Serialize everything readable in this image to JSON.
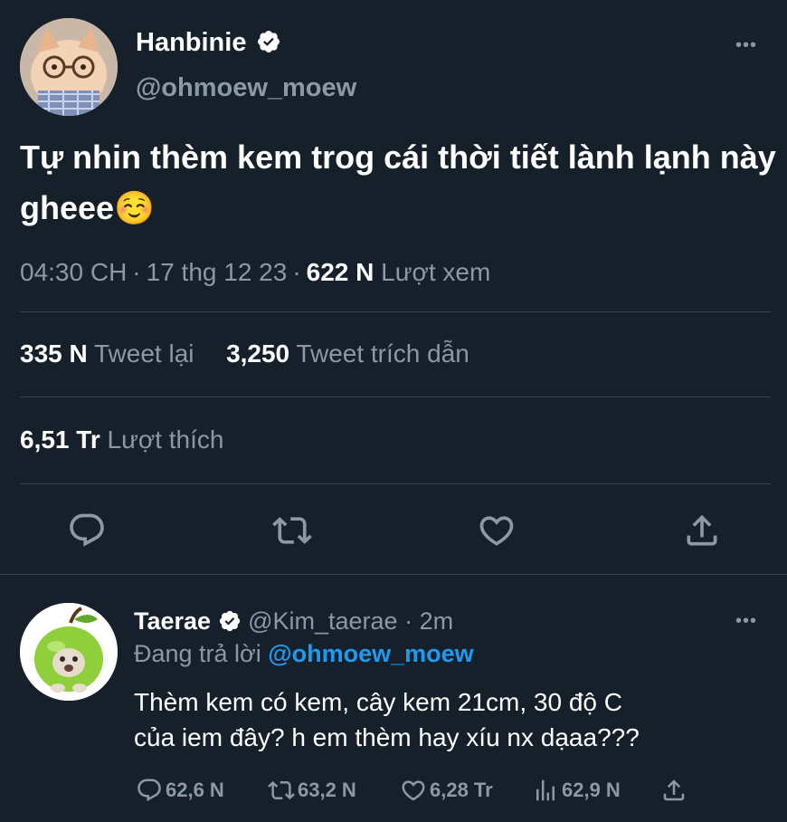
{
  "tweet": {
    "author_name": "Hanbinie",
    "author_handle": "@ohmoew_moew",
    "more_label": "•••",
    "text": "Tự nhin thèm kem trog cái thời tiết lành lạnh này gheee☺️",
    "time": "04:30 CH",
    "date": "17 thg 12 23",
    "views_count": "622 N",
    "views_label": "Lượt xem",
    "retweets_count": "335 N",
    "retweets_label": "Tweet lại",
    "quotes_count": "3,250",
    "quotes_label": "Tweet trích dẫn",
    "likes_count": "6,51 Tr",
    "likes_label": "Lượt thích",
    "verified": true
  },
  "actions": [
    "reply-icon",
    "retweet-icon",
    "like-icon",
    "share-icon"
  ],
  "reply": {
    "author_name": "Taerae",
    "author_handle": "@Kim_taerae",
    "dot": "·",
    "time": "2m",
    "more_label": "•••",
    "replying_prefix": "Đang trả lời",
    "replying_to": "@ohmoew_moew",
    "text_line1": "Thèm kem có kem, cây kem 21cm, 30 độ C",
    "text_line2": "của iem đây? h em thèm hay xíu nx dạaa???",
    "replies": "62,6 N",
    "retweets": "63,2 N",
    "likes": "6,28 Tr",
    "views": "62,9 N"
  },
  "colors": {
    "background": "#15202b",
    "muted": "#8b98a5",
    "divider": "#38444d",
    "link": "#1d9bf0"
  }
}
